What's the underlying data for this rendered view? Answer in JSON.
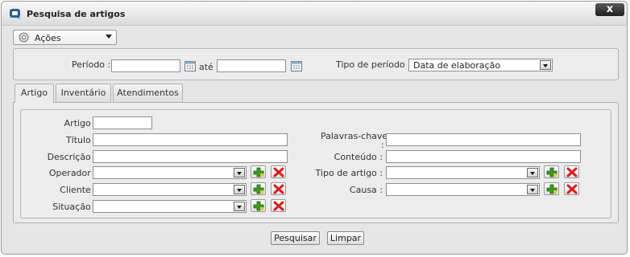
{
  "window": {
    "title": "Pesquisa de artigos",
    "close_label": "x"
  },
  "actions": {
    "label": "Ações",
    "icon": "gear-icon"
  },
  "period": {
    "label": "Período :",
    "until_label": "até",
    "start_value": "",
    "end_value": "",
    "type_label": "Tipo de período :",
    "type_value": "Data de elaboração"
  },
  "tabs": [
    {
      "label": "Artigo",
      "active": true
    },
    {
      "label": "Inventário",
      "active": false
    },
    {
      "label": "Atendimentos",
      "active": false
    }
  ],
  "form": {
    "artigo_label": "Artigo :",
    "titulo_label": "Título :",
    "descricao_label": "Descrição :",
    "operador_label": "Operador :",
    "cliente_label": "Cliente :",
    "situacao_label": "Situação :",
    "palavras_label_1": "Palavras-chave",
    "palavras_label_2": ":",
    "conteudo_label": "Conteúdo :",
    "tipo_label": "Tipo de artigo :",
    "causa_label": "Causa :"
  },
  "buttons": {
    "search": "Pesquisar",
    "clear": "Limpar"
  },
  "colors": {
    "add_green": "#2e8b1e",
    "remove_red": "#d81e1e",
    "close_bg": "#2a2a2a"
  }
}
